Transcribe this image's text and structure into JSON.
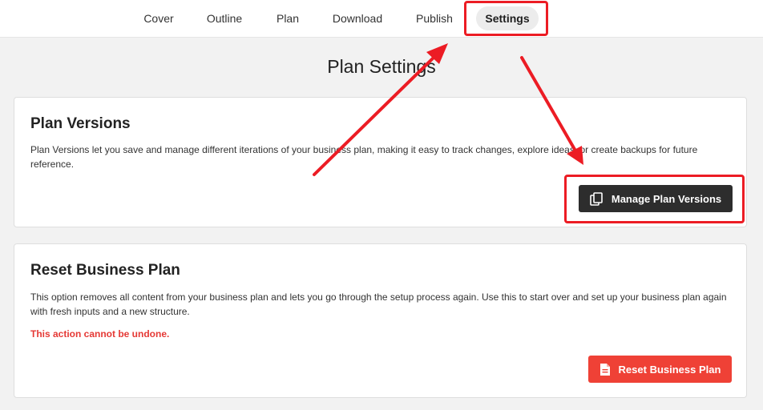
{
  "nav": {
    "tabs": [
      {
        "label": "Cover"
      },
      {
        "label": "Outline"
      },
      {
        "label": "Plan"
      },
      {
        "label": "Download"
      },
      {
        "label": "Publish"
      },
      {
        "label": "Settings",
        "active": true
      }
    ]
  },
  "page": {
    "title": "Plan Settings"
  },
  "plan_versions": {
    "title": "Plan Versions",
    "description": "Plan Versions let you save and manage different iterations of your business plan, making it easy to track changes, explore ideas, or create backups for future reference.",
    "button_label": "Manage Plan Versions",
    "button_icon": "copy-icon"
  },
  "reset_plan": {
    "title": "Reset Business Plan",
    "description": "This option removes all content from your business plan and lets you go through the setup process again. Use this to start over and set up your business plan again with fresh inputs and a new structure.",
    "warning": "This action cannot be undone.",
    "button_label": "Reset Business Plan",
    "button_icon": "document-icon"
  },
  "colors": {
    "annotation": "#ec1c24",
    "danger": "#ef4136",
    "dark_button": "#2d2d2d"
  }
}
